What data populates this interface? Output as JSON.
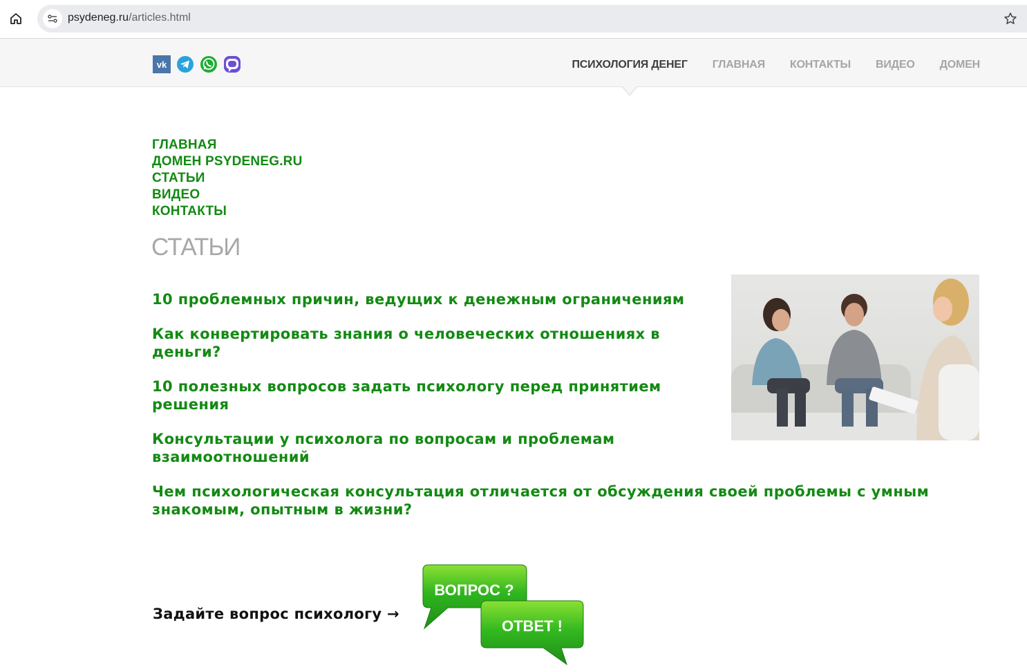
{
  "browser": {
    "url_host": "psydeneg.ru",
    "url_path": "/articles.html"
  },
  "header": {
    "social": [
      "vk-icon",
      "telegram-icon",
      "whatsapp-icon",
      "viber-icon"
    ],
    "nav": [
      {
        "label": "ПСИХОЛОГИЯ ДЕНЕГ",
        "active": true
      },
      {
        "label": "ГЛАВНАЯ",
        "active": false
      },
      {
        "label": "КОНТАКТЫ",
        "active": false
      },
      {
        "label": "ВИДЕО",
        "active": false
      },
      {
        "label": "ДОМЕН",
        "active": false
      }
    ]
  },
  "side_menu": [
    "ГЛАВНАЯ",
    "ДОМЕН PSYDENEG.RU",
    "СТАТЬИ",
    "ВИДЕО",
    "КОНТАКТЫ"
  ],
  "page_title": "СТАТЬИ",
  "articles": [
    "10 проблемных причин, ведущих к денежным ограничениям",
    "Как конвертировать знания о человеческих отношениях в деньги?",
    "10 полезных вопросов задать психологу перед принятием решения",
    "Консультации у психолога по вопросам и проблемам взаимоотношений",
    "Чем психологическая консультация отличается от обсуждения своей проблемы с умным знакомым, опытным в жизни?"
  ],
  "ask_question": "Задайте вопрос психологу →",
  "qa_image": {
    "question": "ВОПРОС ?",
    "answer": "ОТВЕТ !"
  },
  "colors": {
    "link_green": "#138a13",
    "nav_active": "#3e3e3e",
    "nav_inactive": "#a5a5a5",
    "title_gray": "#a8a8a8"
  }
}
